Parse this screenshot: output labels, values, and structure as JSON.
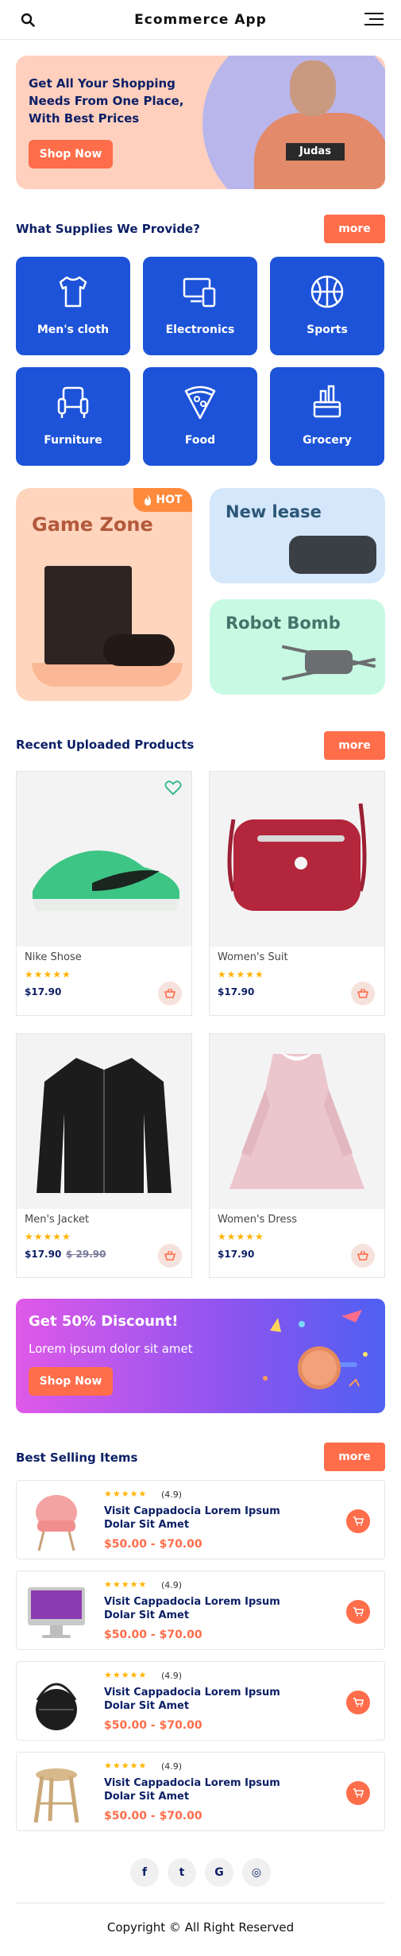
{
  "header": {
    "title": "Ecommerce App",
    "search_icon": "search-icon",
    "menu_icon": "hamburger-menu-icon"
  },
  "hero": {
    "headline": "Get All Your Shopping Needs From One Place, With Best Prices",
    "button_label": "Shop Now",
    "shirt_text": "Judas"
  },
  "supplies": {
    "title": "What Supplies We Provide?",
    "more_label": "more",
    "categories": [
      {
        "label": "Men's cloth",
        "icon": "tshirt-icon"
      },
      {
        "label": "Electronics",
        "icon": "devices-icon"
      },
      {
        "label": "Sports",
        "icon": "basketball-icon"
      },
      {
        "label": "Furniture",
        "icon": "armchair-icon"
      },
      {
        "label": "Food",
        "icon": "pizza-icon"
      },
      {
        "label": "Grocery",
        "icon": "grocery-icon"
      }
    ]
  },
  "promos": {
    "game_zone": {
      "label": "Game Zone",
      "badge": "HOT"
    },
    "new_lease": {
      "label": "New lease"
    },
    "robot_bomb": {
      "label": "Robot Bomb"
    }
  },
  "recent": {
    "title": "Recent Uploaded Products",
    "more_label": "more",
    "products": [
      {
        "name": "Nike Shose",
        "stars": "★★★★★",
        "price": "$17.90",
        "old_price": ""
      },
      {
        "name": "Women's Suit",
        "stars": "★★★★★",
        "price": "$17.90",
        "old_price": ""
      },
      {
        "name": "Men's Jacket",
        "stars": "★★★★★",
        "price": "$17.90",
        "old_price": "$ 29.90"
      },
      {
        "name": "Women's Dress",
        "stars": "★★★★★",
        "price": "$17.90",
        "old_price": ""
      }
    ]
  },
  "discount": {
    "title": "Get 50% Discount!",
    "subtitle": "Lorem ipsum dolor sit amet",
    "button_label": "Shop Now"
  },
  "best_selling": {
    "title": "Best Selling Items",
    "more_label": "more",
    "items": [
      {
        "stars": "★★★★★",
        "rating": "(4.9)",
        "title": "Visit Cappadocia Lorem Ipsum Dolar Sit Amet",
        "price": "$50.00 - $70.00",
        "thumb": "chair"
      },
      {
        "stars": "★★★★★",
        "rating": "(4.9)",
        "title": "Visit Cappadocia Lorem Ipsum Dolar Sit Amet",
        "price": "$50.00 - $70.00",
        "thumb": "imac"
      },
      {
        "stars": "★★★★★",
        "rating": "(4.9)",
        "title": "Visit Cappadocia Lorem Ipsum Dolar Sit Amet",
        "price": "$50.00 - $70.00",
        "thumb": "bag"
      },
      {
        "stars": "★★★★★",
        "rating": "(4.9)",
        "title": "Visit Cappadocia Lorem Ipsum Dolar Sit Amet",
        "price": "$50.00 - $70.00",
        "thumb": "stool"
      }
    ]
  },
  "social": [
    {
      "icon": "facebook-icon",
      "glyph": "f"
    },
    {
      "icon": "twitter-icon",
      "glyph": "t"
    },
    {
      "icon": "google-icon",
      "glyph": "G"
    },
    {
      "icon": "instagram-icon",
      "glyph": "◎"
    }
  ],
  "footer": {
    "copyright": "Copyright © All Right Reserved"
  },
  "colors": {
    "accent": "#ff6d4a",
    "category_blue": "#1d53d8",
    "navy_text": "#0c1f66",
    "star": "#ffb400"
  }
}
